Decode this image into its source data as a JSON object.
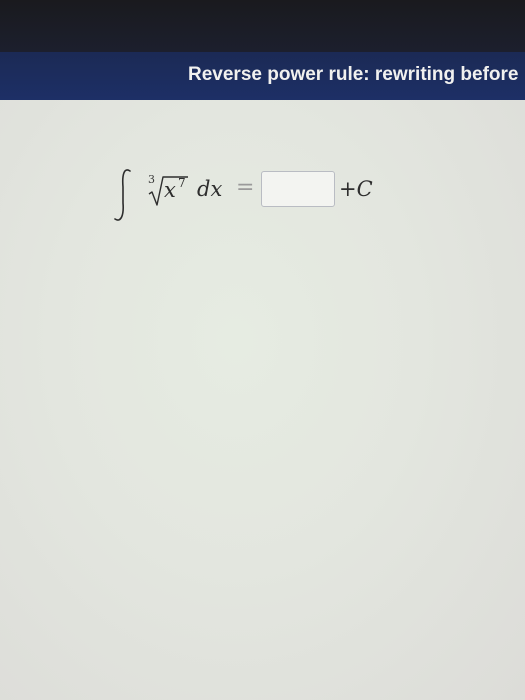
{
  "header": {
    "title": "Reverse power rule: rewriting before"
  },
  "problem": {
    "root_index": "3",
    "variable": "x",
    "exponent": "7",
    "differential": "dx",
    "equals": "=",
    "answer": {
      "value": "",
      "placeholder": ""
    },
    "constant_plus": "+",
    "constant_letter": "C"
  },
  "colors": {
    "header_background": "#1d2f66",
    "header_text": "#f1f1ef",
    "content_background": "#e3e6df",
    "math_text": "#2e2e2e",
    "answer_border": "#b9bcc3"
  }
}
